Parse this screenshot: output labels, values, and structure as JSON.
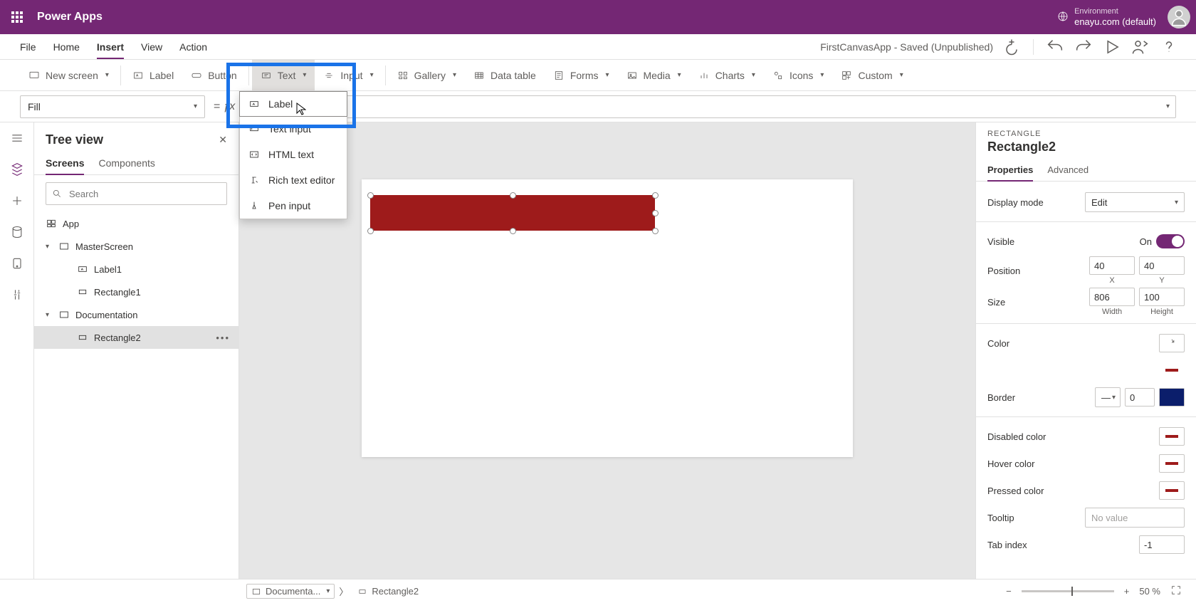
{
  "header": {
    "appName": "Power Apps",
    "envLabel": "Environment",
    "envValue": "enayu.com (default)"
  },
  "menubar": {
    "items": [
      "File",
      "Home",
      "Insert",
      "View",
      "Action"
    ],
    "appStatus": "FirstCanvasApp - Saved (Unpublished)"
  },
  "ribbon": {
    "newScreen": "New screen",
    "label": "Label",
    "button": "Button",
    "text": "Text",
    "input": "Input",
    "gallery": "Gallery",
    "dataTable": "Data table",
    "forms": "Forms",
    "media": "Media",
    "charts": "Charts",
    "icons": "Icons",
    "custom": "Custom"
  },
  "formula": {
    "property": "Fill"
  },
  "textMenu": {
    "items": [
      "Label",
      "Text input",
      "HTML text",
      "Rich text editor",
      "Pen input"
    ]
  },
  "tree": {
    "title": "Tree view",
    "tabs": [
      "Screens",
      "Components"
    ],
    "searchPlaceholder": "Search",
    "app": "App",
    "masterScreen": "MasterScreen",
    "label1": "Label1",
    "rectangle1": "Rectangle1",
    "documentation": "Documentation",
    "rectangle2": "Rectangle2"
  },
  "props": {
    "type": "RECTANGLE",
    "name": "Rectangle2",
    "tabs": [
      "Properties",
      "Advanced"
    ],
    "displayMode": {
      "label": "Display mode",
      "value": "Edit"
    },
    "visible": {
      "label": "Visible",
      "on": "On"
    },
    "position": {
      "label": "Position",
      "x": "40",
      "y": "40",
      "xLabel": "X",
      "yLabel": "Y"
    },
    "size": {
      "label": "Size",
      "w": "806",
      "h": "100",
      "wLabel": "Width",
      "hLabel": "Height"
    },
    "color": {
      "label": "Color"
    },
    "border": {
      "label": "Border",
      "width": "0"
    },
    "disabled": {
      "label": "Disabled color"
    },
    "hover": {
      "label": "Hover color"
    },
    "pressed": {
      "label": "Pressed color"
    },
    "tooltip": {
      "label": "Tooltip",
      "placeholder": "No value"
    },
    "tabIndex": {
      "label": "Tab index",
      "value": "-1"
    }
  },
  "status": {
    "crumb1": "Documenta...",
    "crumb2": "Rectangle2",
    "zoom": "50  %"
  }
}
